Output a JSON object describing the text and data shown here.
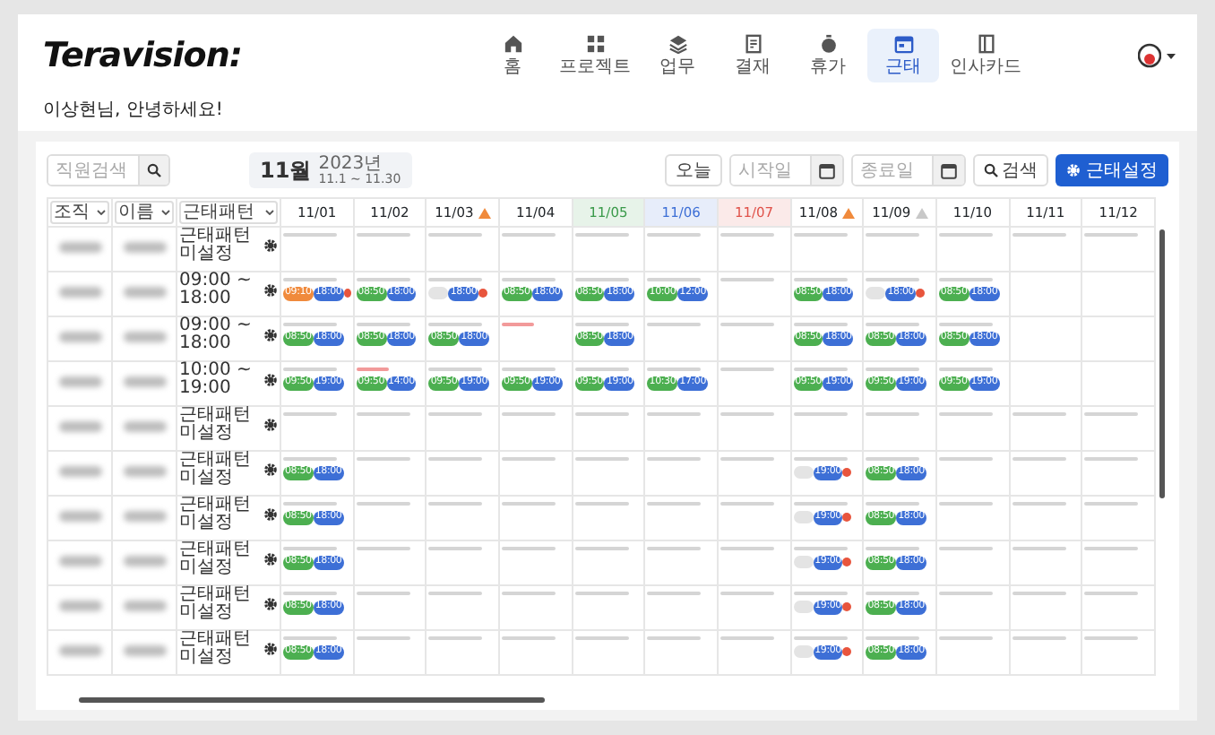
{
  "app": {
    "logo": "Teravision:"
  },
  "nav": [
    {
      "label": "홈",
      "selected": false
    },
    {
      "label": "프로젝트",
      "selected": false
    },
    {
      "label": "업무",
      "selected": false
    },
    {
      "label": "결재",
      "selected": false
    },
    {
      "label": "휴가",
      "selected": false
    },
    {
      "label": "근태",
      "selected": true
    },
    {
      "label": "인사카드",
      "selected": false
    }
  ],
  "greeting": "이상현님, 안녕하세요!",
  "toolbar": {
    "search": {
      "placeholder": "직원검색"
    },
    "month": "11월",
    "year": "2023년",
    "range": "11.1 ~ 11.30",
    "today_button": "오늘",
    "start_date": {
      "placeholder": "시작일"
    },
    "end_date": {
      "placeholder": "종료일"
    },
    "search_button": "검색",
    "settings_button": "근태설정"
  },
  "filters": [
    {
      "label": "조직"
    },
    {
      "label": "이름"
    },
    {
      "label": "근태패턴"
    }
  ],
  "days": [
    {
      "label": "11/01",
      "color": "#212529",
      "kind": "plain"
    },
    {
      "label": "11/02",
      "color": "#212529",
      "kind": "plain"
    },
    {
      "label": "11/03",
      "color": "#212529",
      "kind": "warned"
    },
    {
      "label": "11/04",
      "color": "#212529",
      "kind": "plain"
    },
    {
      "label": "11/05",
      "color": "#3a9a4a",
      "kind": "plain"
    },
    {
      "label": "11/06",
      "color": "#3d6fd6",
      "kind": "plain"
    },
    {
      "label": "11/07",
      "color": "#e0524a",
      "kind": "plain"
    },
    {
      "label": "11/08",
      "color": "#212529",
      "kind": "warned"
    },
    {
      "label": "11/09",
      "color": "#212529",
      "kind": "resolved"
    },
    {
      "label": "11/10",
      "color": "#212529",
      "kind": "plain"
    },
    {
      "label": "11/11",
      "color": "#212529",
      "kind": "plain"
    },
    {
      "label": "11/12",
      "color": "#212529",
      "kind": "plain"
    }
  ],
  "rows": [
    {
      "schedule": "근태패턴 미설정",
      "cells": [
        {
          "kind": "plain"
        },
        {
          "kind": "plain"
        },
        {
          "kind": "plain"
        },
        {
          "kind": "plain"
        },
        {
          "kind": "plain"
        },
        {
          "kind": "plain"
        },
        {
          "kind": "plain"
        },
        {
          "kind": "plain"
        },
        {
          "kind": "plain"
        },
        {
          "kind": "plain"
        },
        {
          "kind": "plain"
        },
        {
          "kind": "plain"
        }
      ]
    },
    {
      "schedule": "09:00 ~ 18:00",
      "cells": [
        {
          "kind": "plain",
          "pills": [
            {
              "kind": "late",
              "text": "09:10"
            },
            {
              "kind": "out",
              "text": "18:00"
            },
            {
              "kind": "flag"
            }
          ]
        },
        {
          "kind": "plain",
          "pills": [
            {
              "kind": "in",
              "text": "08:50"
            },
            {
              "kind": "out",
              "text": "18:00"
            }
          ]
        },
        {
          "kind": "plain",
          "pills": [
            {
              "kind": "missing"
            },
            {
              "kind": "out",
              "text": "18:00"
            },
            {
              "kind": "flag"
            }
          ]
        },
        {
          "kind": "plain",
          "pills": [
            {
              "kind": "in",
              "text": "08:50"
            },
            {
              "kind": "out",
              "text": "18:00"
            }
          ]
        },
        {
          "kind": "plain",
          "pills": [
            {
              "kind": "in",
              "text": "08:50"
            },
            {
              "kind": "out",
              "text": "18:00"
            }
          ]
        },
        {
          "kind": "plain",
          "pills": [
            {
              "kind": "in",
              "text": "10:00"
            },
            {
              "kind": "out",
              "text": "12:00"
            }
          ]
        },
        {
          "kind": "plain"
        },
        {
          "kind": "plain",
          "pills": [
            {
              "kind": "in",
              "text": "08:50"
            },
            {
              "kind": "out",
              "text": "18:00"
            }
          ]
        },
        {
          "kind": "plain",
          "pills": [
            {
              "kind": "missing"
            },
            {
              "kind": "out",
              "text": "18:00"
            },
            {
              "kind": "flag"
            }
          ]
        },
        {
          "kind": "plain",
          "pills": [
            {
              "kind": "in",
              "text": "08:50"
            },
            {
              "kind": "out",
              "text": "18:00"
            }
          ]
        },
        {
          "kind": "blank"
        },
        {
          "kind": "blank"
        }
      ]
    },
    {
      "schedule": "09:00 ~ 18:00",
      "cells": [
        {
          "kind": "plain",
          "pills": [
            {
              "kind": "in",
              "text": "08:50"
            },
            {
              "kind": "out",
              "text": "18:00"
            }
          ]
        },
        {
          "kind": "plain",
          "pills": [
            {
              "kind": "in",
              "text": "08:50"
            },
            {
              "kind": "out",
              "text": "18:00"
            }
          ]
        },
        {
          "kind": "plain",
          "pills": [
            {
              "kind": "in",
              "text": "08:50"
            },
            {
              "kind": "out",
              "text": "18:00"
            }
          ]
        },
        {
          "kind": "warned"
        },
        {
          "kind": "plain",
          "pills": [
            {
              "kind": "in",
              "text": "08:50"
            },
            {
              "kind": "out",
              "text": "18:00"
            }
          ]
        },
        {
          "kind": "plain"
        },
        {
          "kind": "plain"
        },
        {
          "kind": "plain",
          "pills": [
            {
              "kind": "in",
              "text": "08:50"
            },
            {
              "kind": "out",
              "text": "18:00"
            }
          ]
        },
        {
          "kind": "plain",
          "pills": [
            {
              "kind": "in",
              "text": "08:50"
            },
            {
              "kind": "out",
              "text": "18:00"
            }
          ]
        },
        {
          "kind": "plain",
          "pills": [
            {
              "kind": "in",
              "text": "08:50"
            },
            {
              "kind": "out",
              "text": "18:00"
            }
          ]
        },
        {
          "kind": "blank"
        },
        {
          "kind": "blank"
        }
      ]
    },
    {
      "schedule": "10:00 ~ 19:00",
      "cells": [
        {
          "kind": "plain",
          "pills": [
            {
              "kind": "in",
              "text": "09:50"
            },
            {
              "kind": "out",
              "text": "19:00"
            }
          ]
        },
        {
          "kind": "warned",
          "pills": [
            {
              "kind": "in",
              "text": "09:50"
            },
            {
              "kind": "out",
              "text": "14:00"
            }
          ]
        },
        {
          "kind": "plain",
          "pills": [
            {
              "kind": "in",
              "text": "09:50"
            },
            {
              "kind": "out",
              "text": "19:00"
            }
          ]
        },
        {
          "kind": "plain",
          "pills": [
            {
              "kind": "in",
              "text": "09:50"
            },
            {
              "kind": "out",
              "text": "19:00"
            }
          ]
        },
        {
          "kind": "plain",
          "pills": [
            {
              "kind": "in",
              "text": "09:50"
            },
            {
              "kind": "out",
              "text": "19:00"
            }
          ]
        },
        {
          "kind": "plain",
          "pills": [
            {
              "kind": "in",
              "text": "10:30"
            },
            {
              "kind": "out",
              "text": "17:00"
            }
          ]
        },
        {
          "kind": "plain"
        },
        {
          "kind": "plain",
          "pills": [
            {
              "kind": "in",
              "text": "09:50"
            },
            {
              "kind": "out",
              "text": "19:00"
            }
          ]
        },
        {
          "kind": "plain",
          "pills": [
            {
              "kind": "in",
              "text": "09:50"
            },
            {
              "kind": "out",
              "text": "19:00"
            }
          ]
        },
        {
          "kind": "plain",
          "pills": [
            {
              "kind": "in",
              "text": "09:50"
            },
            {
              "kind": "out",
              "text": "19:00"
            }
          ]
        },
        {
          "kind": "blank"
        },
        {
          "kind": "blank"
        }
      ]
    },
    {
      "schedule": "근태패턴 미설정",
      "cells": [
        {
          "kind": "plain"
        },
        {
          "kind": "plain"
        },
        {
          "kind": "plain"
        },
        {
          "kind": "plain"
        },
        {
          "kind": "plain"
        },
        {
          "kind": "plain"
        },
        {
          "kind": "plain"
        },
        {
          "kind": "plain"
        },
        {
          "kind": "plain"
        },
        {
          "kind": "plain"
        },
        {
          "kind": "plain"
        },
        {
          "kind": "plain"
        }
      ]
    },
    {
      "schedule": "근태패턴 미설정",
      "cells": [
        {
          "kind": "plain",
          "pills": [
            {
              "kind": "in",
              "text": "08:50"
            },
            {
              "kind": "out",
              "text": "18:00"
            }
          ]
        },
        {
          "kind": "plain"
        },
        {
          "kind": "plain"
        },
        {
          "kind": "plain"
        },
        {
          "kind": "plain"
        },
        {
          "kind": "plain"
        },
        {
          "kind": "plain"
        },
        {
          "kind": "plain",
          "pills": [
            {
              "kind": "missing"
            },
            {
              "kind": "out",
              "text": "19:00"
            },
            {
              "kind": "flag"
            }
          ]
        },
        {
          "kind": "plain",
          "pills": [
            {
              "kind": "in",
              "text": "08:50"
            },
            {
              "kind": "out",
              "text": "18:00"
            }
          ]
        },
        {
          "kind": "plain"
        },
        {
          "kind": "plain"
        },
        {
          "kind": "plain"
        }
      ]
    },
    {
      "schedule": "근태패턴 미설정",
      "cells": [
        {
          "kind": "plain",
          "pills": [
            {
              "kind": "in",
              "text": "08:50"
            },
            {
              "kind": "out",
              "text": "18:00"
            }
          ]
        },
        {
          "kind": "plain"
        },
        {
          "kind": "plain"
        },
        {
          "kind": "plain"
        },
        {
          "kind": "plain"
        },
        {
          "kind": "plain"
        },
        {
          "kind": "plain"
        },
        {
          "kind": "plain",
          "pills": [
            {
              "kind": "missing"
            },
            {
              "kind": "out",
              "text": "19:00"
            },
            {
              "kind": "flag"
            }
          ]
        },
        {
          "kind": "plain",
          "pills": [
            {
              "kind": "in",
              "text": "08:50"
            },
            {
              "kind": "out",
              "text": "18:00"
            }
          ]
        },
        {
          "kind": "plain"
        },
        {
          "kind": "plain"
        },
        {
          "kind": "plain"
        }
      ]
    },
    {
      "schedule": "근태패턴 미설정",
      "cells": [
        {
          "kind": "plain",
          "pills": [
            {
              "kind": "in",
              "text": "08:50"
            },
            {
              "kind": "out",
              "text": "18:00"
            }
          ]
        },
        {
          "kind": "plain"
        },
        {
          "kind": "plain"
        },
        {
          "kind": "plain"
        },
        {
          "kind": "plain"
        },
        {
          "kind": "plain"
        },
        {
          "kind": "plain"
        },
        {
          "kind": "plain",
          "pills": [
            {
              "kind": "missing"
            },
            {
              "kind": "out",
              "text": "19:00"
            },
            {
              "kind": "flag"
            }
          ]
        },
        {
          "kind": "plain",
          "pills": [
            {
              "kind": "in",
              "text": "08:50"
            },
            {
              "kind": "out",
              "text": "18:00"
            }
          ]
        },
        {
          "kind": "plain"
        },
        {
          "kind": "plain"
        },
        {
          "kind": "plain"
        }
      ]
    },
    {
      "schedule": "근태패턴 미설정",
      "cells": [
        {
          "kind": "plain",
          "pills": [
            {
              "kind": "in",
              "text": "08:50"
            },
            {
              "kind": "out",
              "text": "18:00"
            }
          ]
        },
        {
          "kind": "plain"
        },
        {
          "kind": "plain"
        },
        {
          "kind": "plain"
        },
        {
          "kind": "plain"
        },
        {
          "kind": "plain"
        },
        {
          "kind": "plain"
        },
        {
          "kind": "plain",
          "pills": [
            {
              "kind": "missing"
            },
            {
              "kind": "out",
              "text": "19:00"
            },
            {
              "kind": "flag"
            }
          ]
        },
        {
          "kind": "plain",
          "pills": [
            {
              "kind": "in",
              "text": "08:50"
            },
            {
              "kind": "out",
              "text": "18:00"
            }
          ]
        },
        {
          "kind": "plain"
        },
        {
          "kind": "plain"
        },
        {
          "kind": "plain"
        }
      ]
    },
    {
      "schedule": "근태패턴 미설정",
      "cells": [
        {
          "kind": "plain",
          "pills": [
            {
              "kind": "in",
              "text": "08:50"
            },
            {
              "kind": "out",
              "text": "18:00"
            }
          ]
        },
        {
          "kind": "plain"
        },
        {
          "kind": "plain"
        },
        {
          "kind": "plain"
        },
        {
          "kind": "plain"
        },
        {
          "kind": "plain"
        },
        {
          "kind": "plain"
        },
        {
          "kind": "plain",
          "pills": [
            {
              "kind": "missing"
            },
            {
              "kind": "out",
              "text": "19:00"
            },
            {
              "kind": "flag"
            }
          ]
        },
        {
          "kind": "plain",
          "pills": [
            {
              "kind": "in",
              "text": "08:50"
            },
            {
              "kind": "out",
              "text": "18:00"
            }
          ]
        },
        {
          "kind": "plain"
        },
        {
          "kind": "plain"
        },
        {
          "kind": "plain"
        }
      ]
    }
  ]
}
